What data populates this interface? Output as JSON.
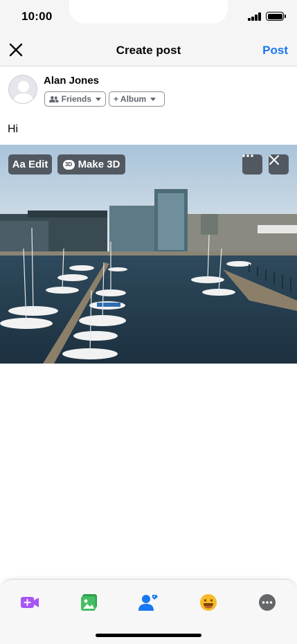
{
  "status_bar": {
    "time": "10:00"
  },
  "header": {
    "title": "Create post",
    "post_label": "Post"
  },
  "author": {
    "name": "Alan Jones"
  },
  "audience": {
    "label": "Friends"
  },
  "album": {
    "label": "+ Album"
  },
  "post": {
    "text": "Hi"
  },
  "photo_toolbar": {
    "edit_label": "Aa Edit",
    "make3d_label": "Make 3D",
    "make3d_badge": "3D"
  },
  "bottom_tools": [
    "video-icon",
    "photo-icon",
    "tag-people-icon",
    "feeling-icon",
    "more-options-icon"
  ],
  "colors": {
    "accent": "#1877f2",
    "video": "#a855f7",
    "photo": "#45bd62",
    "feeling": "#f7b928",
    "more": "#65676b"
  }
}
